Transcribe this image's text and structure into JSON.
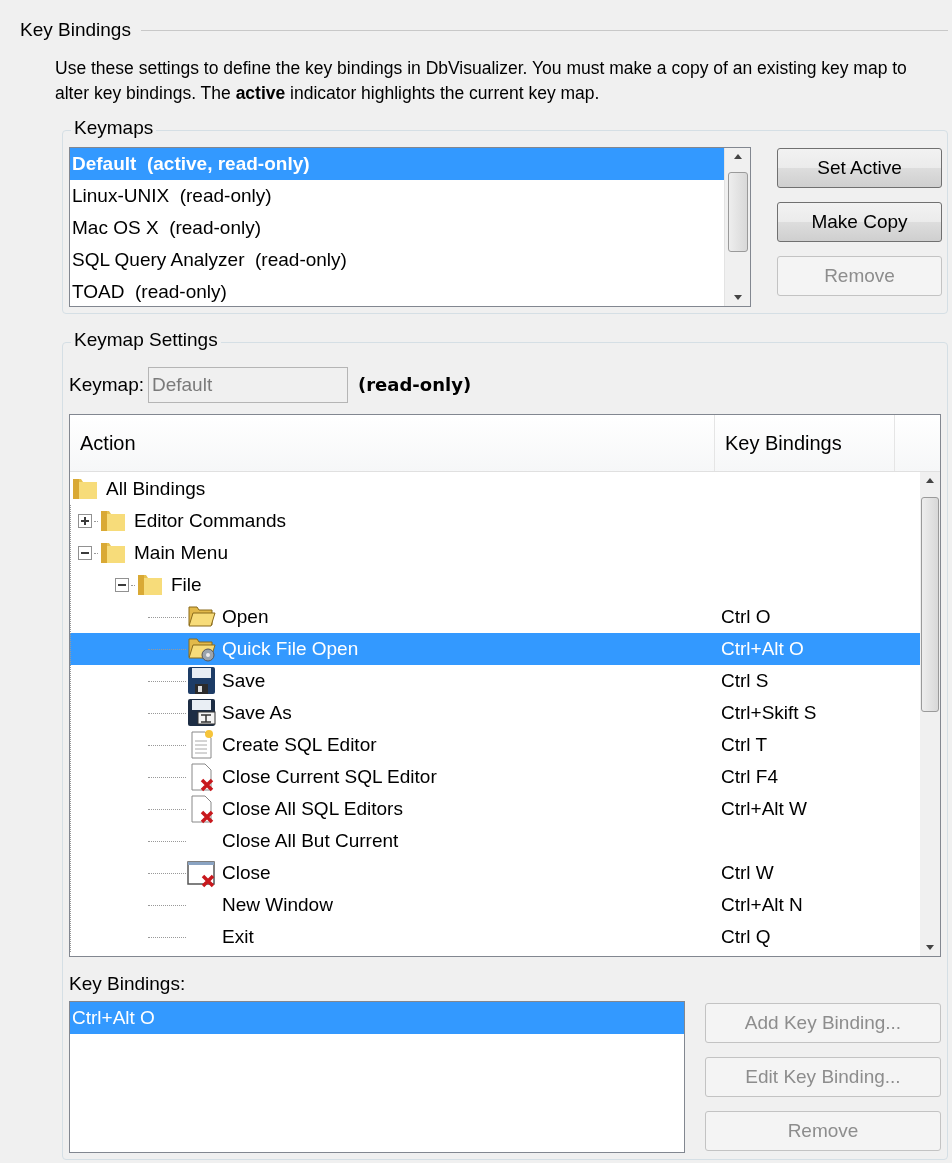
{
  "section_title": "Key Bindings",
  "description": "Use these settings to define the key bindings in DbVisualizer. You must make a copy of an existing key map to alter key bindings. The **active** indicator highlights the current key map.",
  "keymaps": {
    "label": "Keymaps",
    "items": [
      {
        "label": "Default  (active, read-only)",
        "active": true,
        "selected": true
      },
      {
        "label": "Linux-UNIX  (read-only)",
        "active": false,
        "selected": false
      },
      {
        "label": "Mac OS X  (read-only)",
        "active": false,
        "selected": false
      },
      {
        "label": "SQL Query Analyzer  (read-only)",
        "active": false,
        "selected": false
      },
      {
        "label": "TOAD  (read-only)",
        "active": false,
        "selected": false
      }
    ],
    "buttons": [
      {
        "label": "Set Active",
        "disabled": false
      },
      {
        "label": "Make Copy",
        "disabled": false
      },
      {
        "label": "Remove",
        "disabled": true
      }
    ]
  },
  "keymap_settings": {
    "label": "Keymap Settings",
    "keymap_field": {
      "label": "Keymap:",
      "value": "Default",
      "disabled": true
    },
    "note": "(read-only)",
    "tree": {
      "columns": [
        "Action",
        "Key Bindings"
      ],
      "rows": [
        {
          "label": "All Bindings",
          "kind": "folder",
          "selected": false,
          "children": [
            {
              "label": "Editor Commands",
              "kind": "folder",
              "expanded": false,
              "selected": false
            },
            {
              "label": "Main Menu",
              "kind": "folder",
              "expanded": true,
              "selected": false,
              "children": [
                {
                  "label": "File",
                  "kind": "folder",
                  "expanded": true,
                  "selected": false,
                  "children": [
                    {
                      "label": "Open",
                      "kind": "open",
                      "key": "Ctrl O",
                      "selected": false
                    },
                    {
                      "label": "Quick File Open",
                      "kind": "quickopen",
                      "key": "Ctrl+Alt O",
                      "selected": true
                    },
                    {
                      "label": "Save",
                      "kind": "save",
                      "key": "Ctrl S",
                      "selected": false
                    },
                    {
                      "label": "Save As",
                      "kind": "saveas",
                      "key": "Ctrl+Skift S",
                      "selected": false
                    },
                    {
                      "label": "Create SQL Editor",
                      "kind": "create",
                      "key": "Ctrl T",
                      "selected": false
                    },
                    {
                      "label": "Close Current SQL Editor",
                      "kind": "closedoc",
                      "key": "Ctrl F4",
                      "selected": false
                    },
                    {
                      "label": "Close All SQL Editors",
                      "kind": "closedoc",
                      "key": "Ctrl+Alt W",
                      "selected": false
                    },
                    {
                      "label": "Close All But Current",
                      "kind": "plain",
                      "selected": false
                    },
                    {
                      "label": "Close",
                      "kind": "closewin",
                      "key": "Ctrl W",
                      "selected": false
                    },
                    {
                      "label": "New Window",
                      "kind": "plain",
                      "key": "Ctrl+Alt N",
                      "selected": false
                    },
                    {
                      "label": "Exit",
                      "kind": "plain",
                      "key": "Ctrl Q",
                      "selected": false
                    }
                  ]
                }
              ]
            }
          ]
        }
      ]
    },
    "bindings_label": "Key Bindings:",
    "bindings": [
      {
        "label": "Ctrl+Alt O",
        "selected": true
      }
    ],
    "buttons": [
      {
        "label": "Add Key Binding...",
        "disabled": true
      },
      {
        "label": "Edit Key Binding...",
        "disabled": true
      },
      {
        "label": "Remove",
        "disabled": true
      }
    ]
  }
}
